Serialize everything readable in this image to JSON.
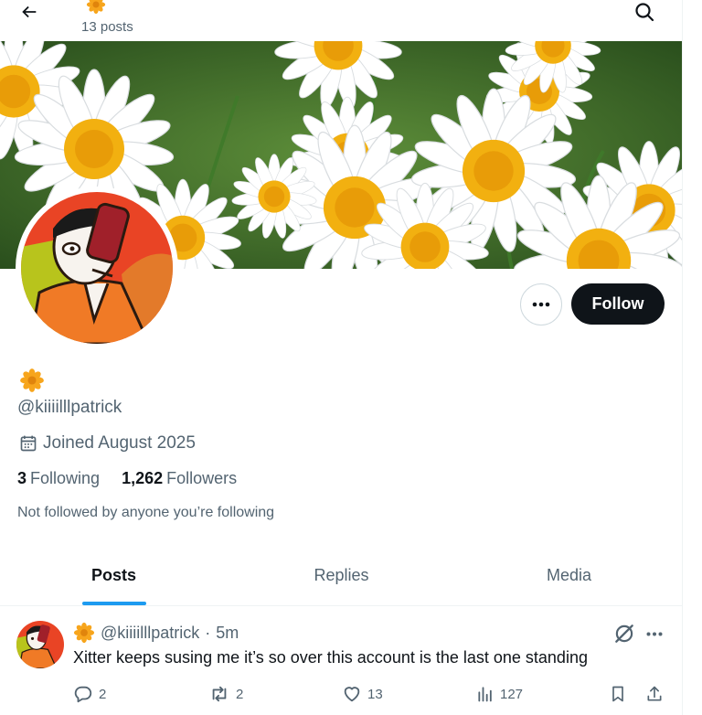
{
  "header": {
    "posts_count": "13 posts",
    "back_icon": "arrow-left-icon",
    "search_icon": "search-icon"
  },
  "profile": {
    "display_name_icon": "sunflower-emoji",
    "handle": "@kiiiilllpatrick",
    "joined": "Joined August 2025",
    "following_count": "3",
    "following_label": "Following",
    "followers_count": "1,262",
    "followers_label": "Followers",
    "not_followed_text": "Not followed by anyone you’re following"
  },
  "actions": {
    "follow_label": "Follow",
    "more_icon": "more-dots-icon"
  },
  "tabs": [
    {
      "label": "Posts",
      "active": true
    },
    {
      "label": "Replies",
      "active": false
    },
    {
      "label": "Media",
      "active": false
    }
  ],
  "post": {
    "handle": "@kiiiilllpatrick",
    "separator": "·",
    "time": "5m",
    "text": "Xitter keeps susing me it’s so over this account is the last one standing",
    "replies": "2",
    "reposts": "2",
    "likes": "13",
    "views": "127"
  },
  "colors": {
    "accent": "#1d9bf0",
    "text_primary": "#0f1419",
    "text_secondary": "#536471",
    "follow_button": "#0f1419"
  }
}
